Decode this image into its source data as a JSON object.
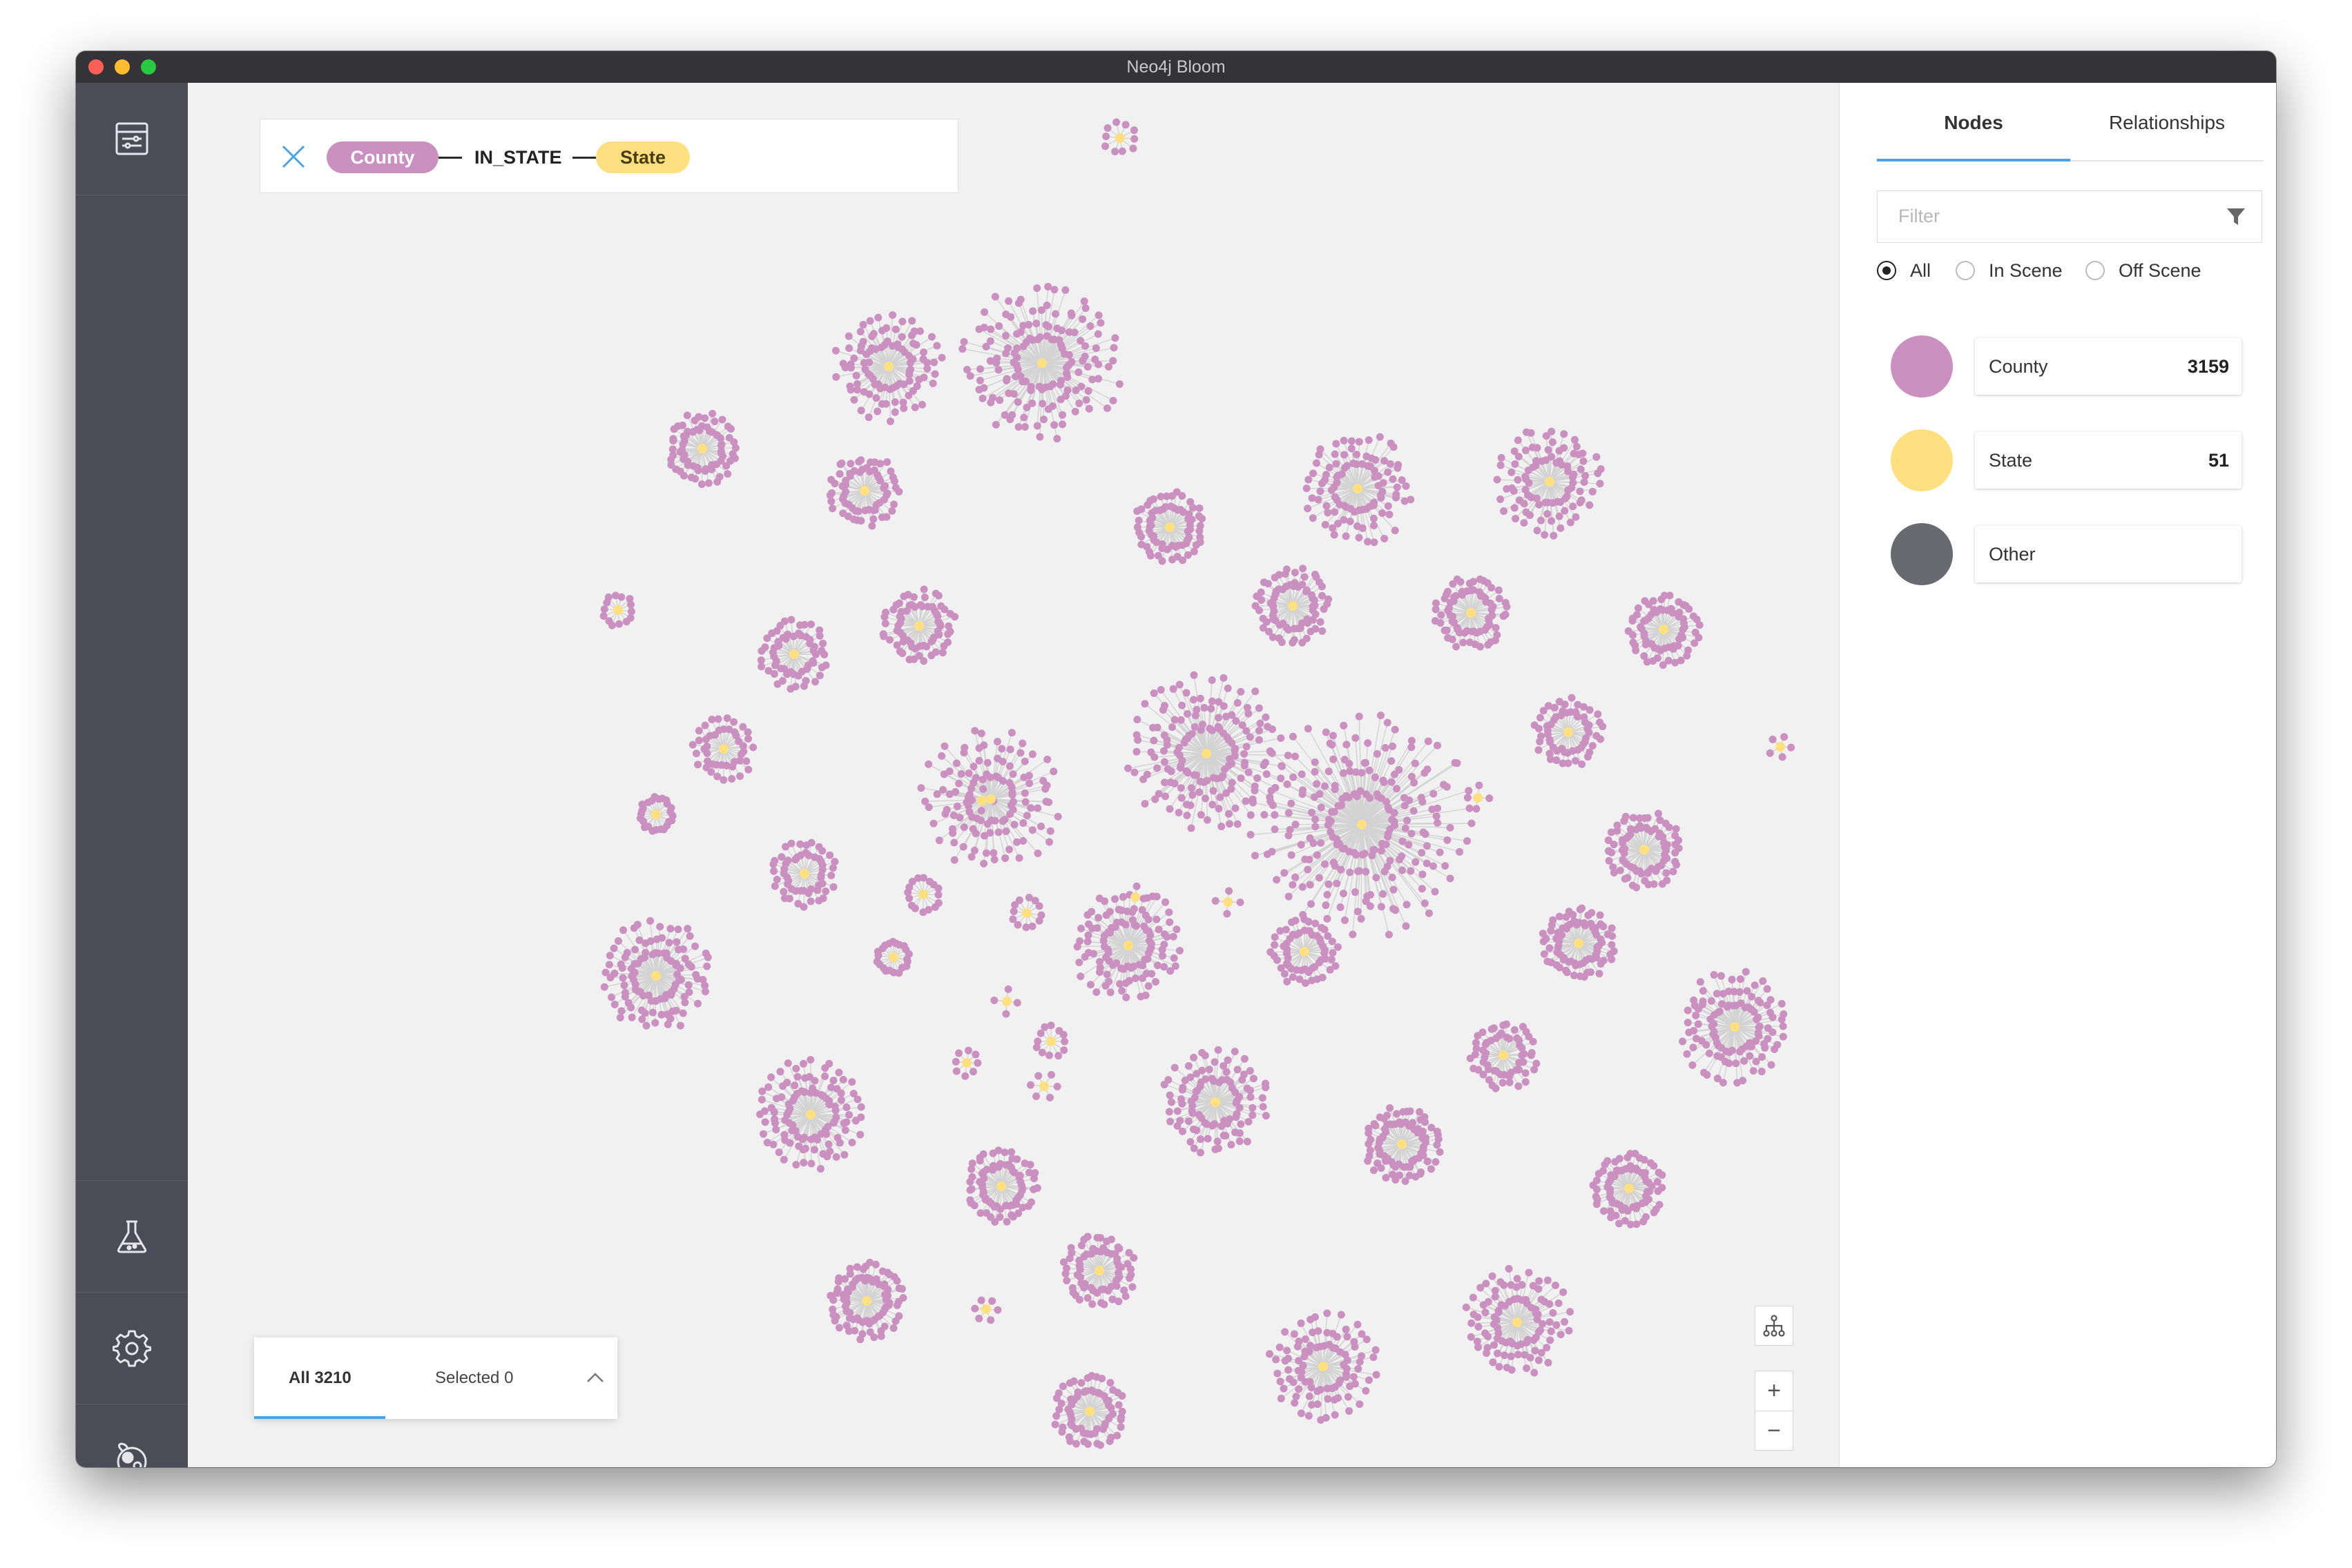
{
  "window": {
    "title": "Neo4j Bloom"
  },
  "search": {
    "from_label": "County",
    "relationship": "IN_STATE",
    "to_label": "State"
  },
  "result_bar": {
    "all_label": "All 3210",
    "selected_label": "Selected 0"
  },
  "panel": {
    "tabs": {
      "nodes": "Nodes",
      "relationships": "Relationships"
    },
    "filter_placeholder": "Filter",
    "radios": {
      "all": "All",
      "in_scene": "In Scene",
      "off_scene": "Off Scene"
    },
    "categories": [
      {
        "name": "County",
        "count": "3159",
        "color": "#c990c0"
      },
      {
        "name": "State",
        "count": "51",
        "color": "#ffe081"
      },
      {
        "name": "Other",
        "count": "",
        "color": "#696970"
      }
    ]
  },
  "zoom": {
    "in": "+",
    "out": "−"
  },
  "graph": {
    "node_counts": {
      "County": 3159,
      "State": 51
    },
    "colors": {
      "county": "#c990c0",
      "state": "#ffe081",
      "edge": "#d3d3d3"
    }
  },
  "icons": {
    "sidebar_top": "perspective-icon",
    "sidebar_b1": "flask-icon",
    "sidebar_b2": "gear-icon",
    "sidebar_b3": "bloom-logo-icon"
  }
}
